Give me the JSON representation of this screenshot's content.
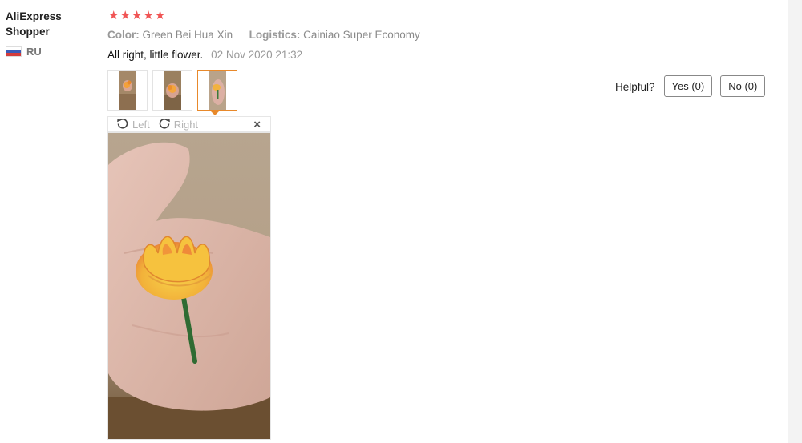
{
  "buyer": {
    "name": "AliExpress Shopper",
    "country": "RU"
  },
  "review": {
    "rating_stars": 5,
    "attributes": [
      {
        "label": "Color:",
        "value": "Green Bei Hua Xin"
      },
      {
        "label": "Logistics:",
        "value": "Cainiao Super Economy"
      }
    ],
    "text": "All right, little flower.",
    "date": "02 Nov 2020 21:32"
  },
  "thumbnails": {
    "count": 3,
    "active_index": 2
  },
  "viewer": {
    "rotate_left": "Left",
    "rotate_right": "Right",
    "close": "×"
  },
  "helpful": {
    "label": "Helpful?",
    "yes": "Yes (0)",
    "no": "No (0)"
  },
  "colors": {
    "star": "#f05454",
    "active_border": "#e8892b"
  }
}
